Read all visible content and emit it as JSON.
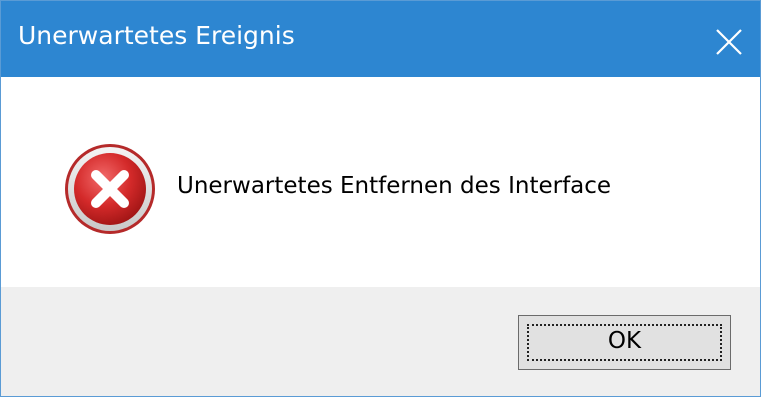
{
  "window": {
    "title": "Unerwartetes Ereignis",
    "close_icon": "close-icon",
    "titlebar_color": "#2d86d1"
  },
  "dialog": {
    "icon": "error-icon",
    "message": "Unerwartetes Entfernen des Interface"
  },
  "footer": {
    "ok_label": "OK"
  }
}
